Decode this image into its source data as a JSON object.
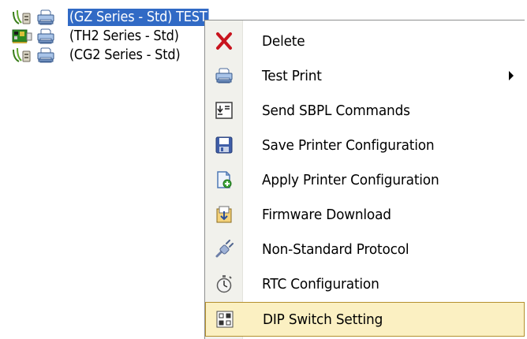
{
  "printer_tree": {
    "items": [
      {
        "label": "(GZ Series - Std) TEST",
        "connection_icon": "serial-cable-icon",
        "icon": "printer-icon",
        "selected": true
      },
      {
        "label": "(TH2 Series - Std)",
        "connection_icon": "network-card-icon",
        "icon": "printer-icon",
        "selected": false
      },
      {
        "label": "(CG2 Series - Std)",
        "connection_icon": "serial-cable-icon",
        "icon": "printer-icon",
        "selected": false
      }
    ]
  },
  "context_menu": {
    "items": [
      {
        "label": "Delete",
        "icon": "delete-x-icon"
      },
      {
        "label": "Test Print",
        "icon": "printer-icon",
        "has_submenu": true
      },
      {
        "label": "Send SBPL Commands",
        "icon": "send-commands-icon"
      },
      {
        "label": "Save Printer Configuration",
        "icon": "save-floppy-icon"
      },
      {
        "label": "Apply Printer Configuration",
        "icon": "apply-config-icon"
      },
      {
        "label": "Firmware Download",
        "icon": "firmware-download-icon"
      },
      {
        "label": "Non-Standard Protocol",
        "icon": "protocol-plug-icon"
      },
      {
        "label": "RTC Configuration",
        "icon": "stopwatch-icon"
      },
      {
        "label": "DIP Switch Setting",
        "icon": "dip-switch-icon",
        "hovered": true
      }
    ]
  },
  "colors": {
    "selection": "#316ac5",
    "menu_hover_bg": "#fbf0c2",
    "menu_hover_border": "#b4902e",
    "menu_gutter": "#f1f1ec",
    "delete_red": "#c8141e"
  }
}
